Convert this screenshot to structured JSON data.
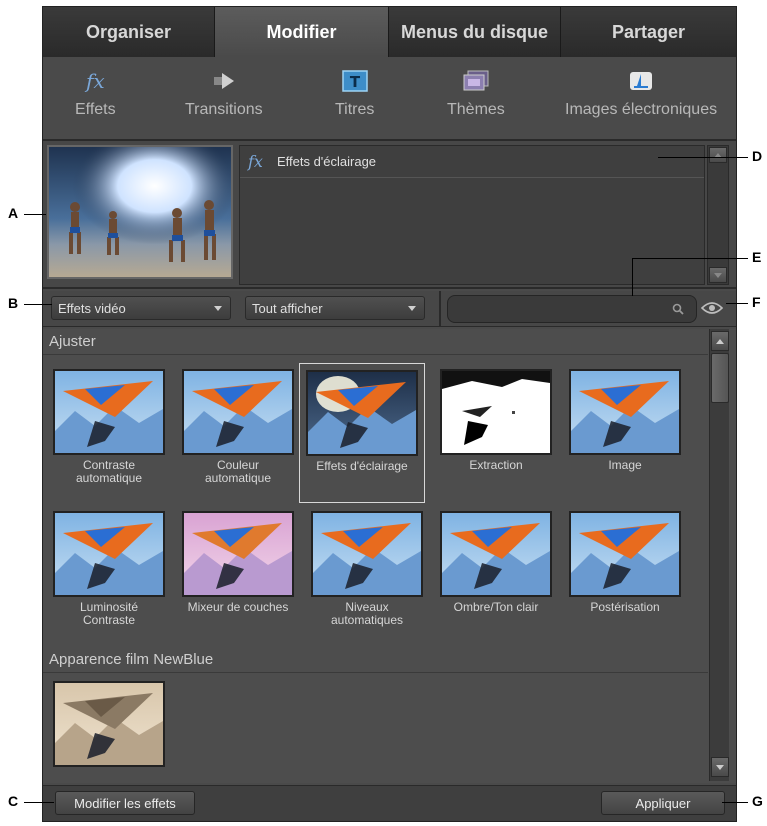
{
  "tabs": [
    {
      "label": "Organiser",
      "active": false
    },
    {
      "label": "Modifier",
      "active": true
    },
    {
      "label": "Menus du disque",
      "active": false
    },
    {
      "label": "Partager",
      "active": false
    }
  ],
  "toolbar": {
    "items": [
      {
        "label": "Effets",
        "icon": "fx-icon"
      },
      {
        "label": "Transitions",
        "icon": "transition-arrow-icon"
      },
      {
        "label": "Titres",
        "icon": "title-T-icon"
      },
      {
        "label": "Thèmes",
        "icon": "themes-icon"
      },
      {
        "label": "Images électroniques",
        "icon": "clipart-icon"
      }
    ]
  },
  "preview": {
    "title": "Effets d'éclairage",
    "fx_glyph": "fx"
  },
  "filters": {
    "category": "Effets vidéo",
    "show": "Tout afficher",
    "search_placeholder": ""
  },
  "sections": [
    {
      "title": "Ajuster",
      "items": [
        {
          "caption": "Contraste\nautomatique",
          "variant": "normal",
          "selected": false
        },
        {
          "caption": "Couleur\nautomatique",
          "variant": "normal",
          "selected": false
        },
        {
          "caption": "Effets d'éclairage",
          "variant": "light",
          "selected": true
        },
        {
          "caption": "Extraction",
          "variant": "extract",
          "selected": false
        },
        {
          "caption": "Image",
          "variant": "normal",
          "selected": false
        },
        {
          "caption": "Luminosité\nContraste",
          "variant": "normal",
          "selected": false
        },
        {
          "caption": "Mixeur de couches",
          "variant": "pink",
          "selected": false
        },
        {
          "caption": "Niveaux\nautomatiques",
          "variant": "normal",
          "selected": false
        },
        {
          "caption": "Ombre/Ton clair",
          "variant": "normal",
          "selected": false
        },
        {
          "caption": "Postérisation",
          "variant": "normal",
          "selected": false
        }
      ]
    },
    {
      "title": "Apparence film NewBlue",
      "items": [
        {
          "caption": "",
          "variant": "sepia",
          "selected": false
        }
      ]
    }
  ],
  "buttons": {
    "edit_effects": "Modifier les effets",
    "apply": "Appliquer"
  },
  "callouts": {
    "A": "A",
    "B": "B",
    "C": "C",
    "D": "D",
    "E": "E",
    "F": "F",
    "G": "G"
  },
  "colors": {
    "panel": "#4a4a4a",
    "tab_active": "#5c5c5c",
    "fx_blue": "#7aa7d8"
  }
}
